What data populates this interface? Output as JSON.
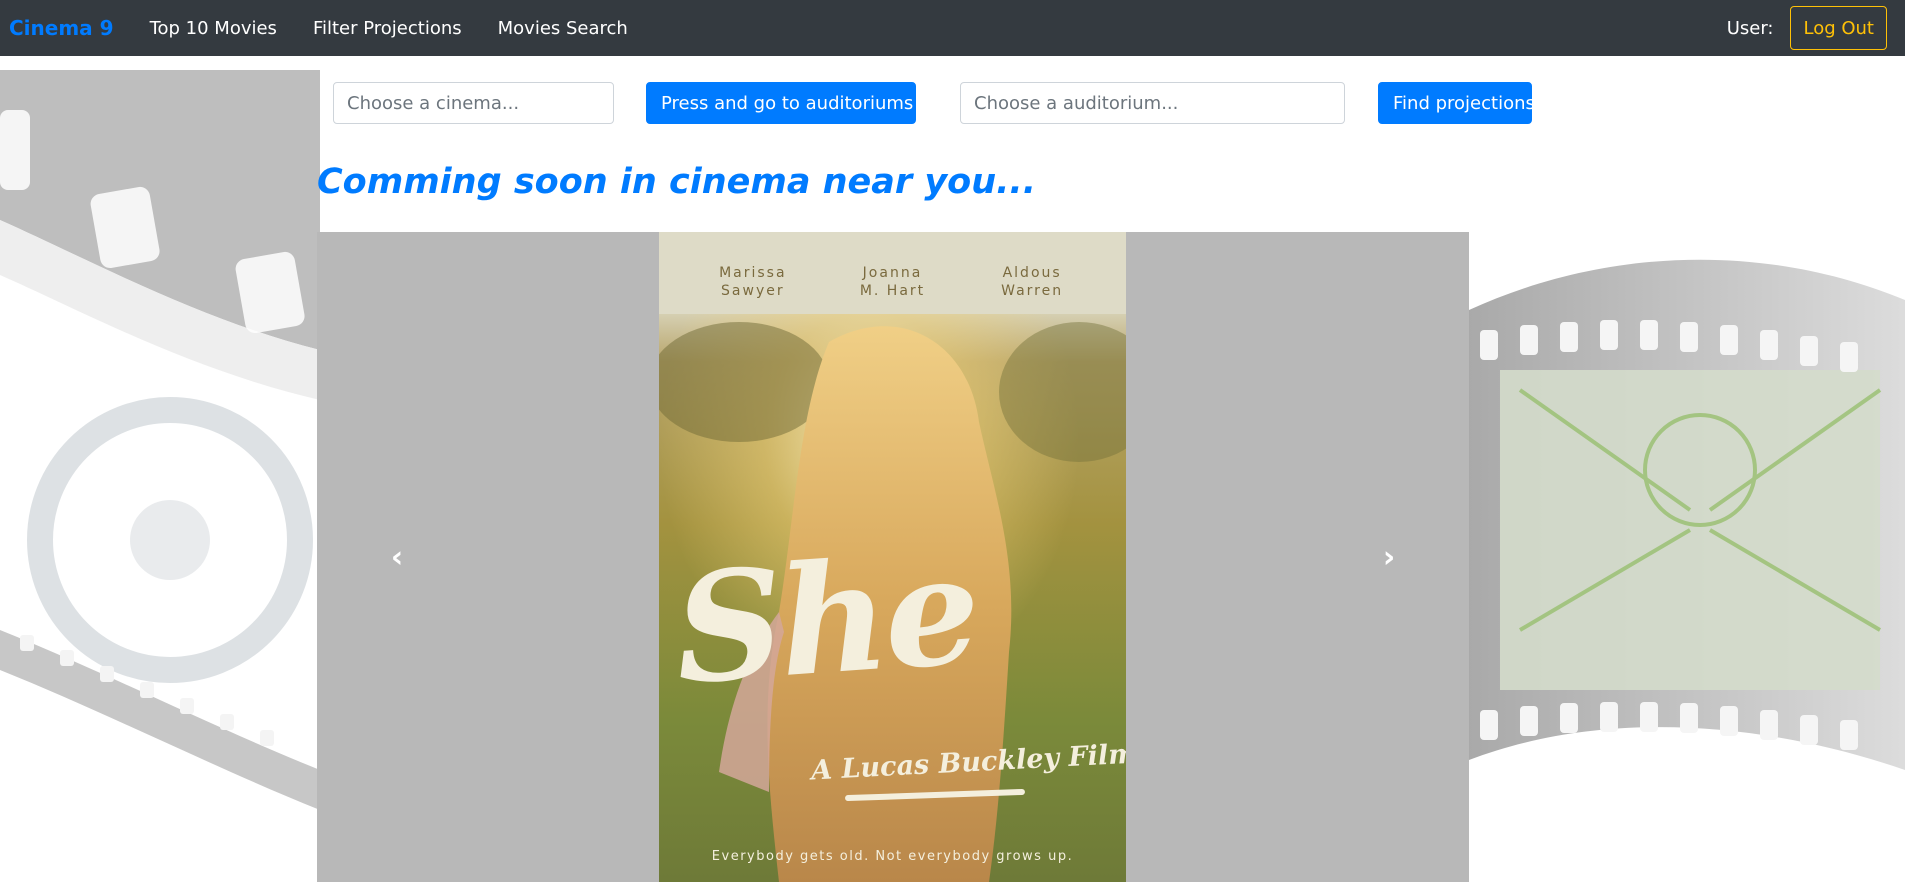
{
  "navbar": {
    "brand": "Cinema 9",
    "links": [
      {
        "label": "Top 10 Movies"
      },
      {
        "label": "Filter Projections"
      },
      {
        "label": "Movies Search"
      }
    ],
    "user_label": "User:",
    "logout_label": "Log Out"
  },
  "controls": {
    "cinema_placeholder": "Choose a cinema...",
    "go_button_label": "Press and go to auditoriums",
    "go_button_icon": "hand-pointing-right-icon",
    "auditorium_placeholder": "Choose a auditorium...",
    "find_button_label": "Find projections"
  },
  "heading": "Comming soon in cinema near you...",
  "carousel": {
    "prev_icon": "chevron-left-icon",
    "next_icon": "chevron-right-icon",
    "current_slide": {
      "cast": [
        "Marissa\nSawyer",
        "Joanna\nM. Hart",
        "Aldous\nWarren"
      ],
      "title": "She",
      "subtitle": "A Lucas Buckley Film",
      "tagline": "Everybody gets old. Not everybody grows up."
    }
  },
  "colors": {
    "navbar_bg": "#343a40",
    "brand": "#007bff",
    "primary": "#007bff",
    "warning": "#ffc107",
    "carousel_bg": "#b8b8b8"
  }
}
